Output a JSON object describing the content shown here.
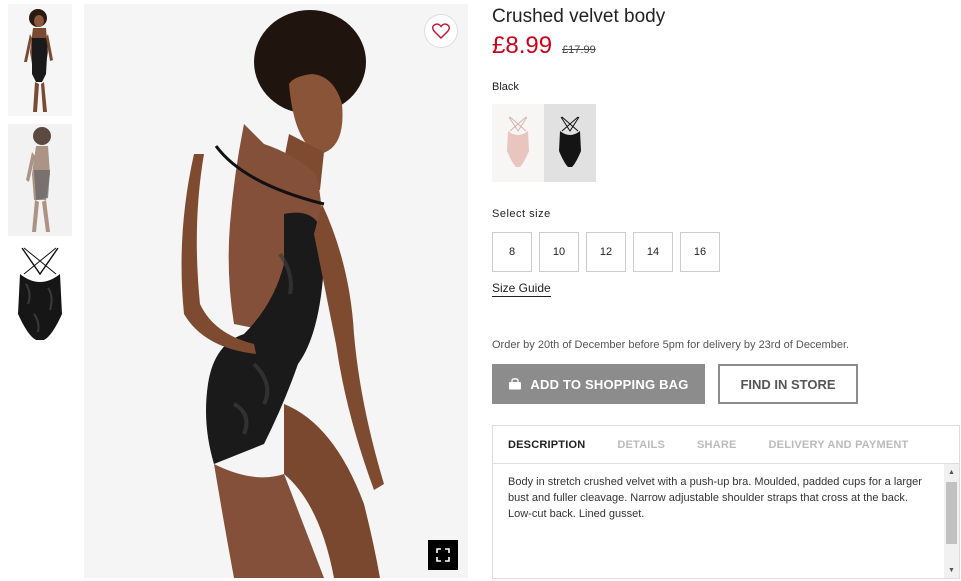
{
  "product": {
    "title": "Crushed velvet body",
    "price": "£8.99",
    "old_price": "£17.99"
  },
  "colors": {
    "selected_label": "Black",
    "options": [
      "light-pink",
      "black"
    ]
  },
  "sizes": {
    "label": "Select size",
    "options": [
      "8",
      "10",
      "12",
      "14",
      "16"
    ],
    "guide_label": "Size Guide"
  },
  "delivery_note": "Order by 20th of December before 5pm for delivery by 23rd of December.",
  "buttons": {
    "add_to_bag": "ADD TO SHOPPING BAG",
    "find_in_store": "FIND IN STORE"
  },
  "tabs": [
    "DESCRIPTION",
    "DETAILS",
    "SHARE",
    "DELIVERY AND PAYMENT"
  ],
  "description": "Body in stretch crushed velvet with a push-up bra. Moulded, padded cups for a larger bust and fuller cleavage. Narrow adjustable shoulder straps that cross at the back. Low-cut back. Lined gusset.",
  "icons": {
    "favourite": "heart-icon",
    "zoom": "expand-icon",
    "bag": "shopping-bag-icon"
  },
  "colors_theme": {
    "price": "#d0021b",
    "button_grey": "#8c8c8c"
  }
}
